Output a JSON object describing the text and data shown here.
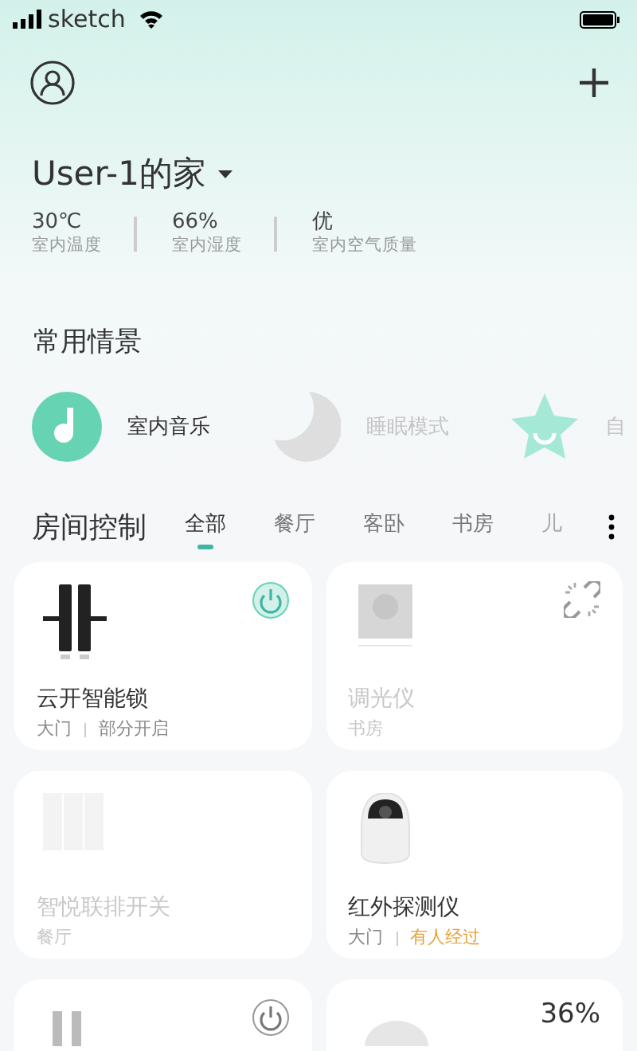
{
  "status_bar": {
    "carrier": "sketch"
  },
  "home": {
    "title": "User-1的家"
  },
  "stats": [
    {
      "value": "30℃",
      "label": "室内温度"
    },
    {
      "value": "66%",
      "label": "室内湿度"
    },
    {
      "value": "优",
      "label": "室内空气质量"
    }
  ],
  "scenes_title": "常用情景",
  "scenes": [
    {
      "kind": "music",
      "label": "室内音乐",
      "active": true
    },
    {
      "kind": "moon",
      "label": "睡眠模式",
      "active": false
    },
    {
      "kind": "star",
      "label": "自",
      "active": false
    }
  ],
  "rooms": {
    "title": "房间控制",
    "tabs": [
      {
        "label": "全部",
        "selected": true
      },
      {
        "label": "餐厅",
        "selected": false
      },
      {
        "label": "客卧",
        "selected": false
      },
      {
        "label": "书房",
        "selected": false
      },
      {
        "label": "儿",
        "selected": false
      }
    ]
  },
  "devices": [
    {
      "kind": "lock",
      "name": "云开智能锁",
      "room": "大门",
      "status": "部分开启",
      "status_alert": false,
      "online": true,
      "unlinked": false,
      "power_on": true
    },
    {
      "kind": "dimmer",
      "name": "调光仪",
      "room": "书房",
      "online": false,
      "unlinked": true
    },
    {
      "kind": "switch",
      "name": "智悦联排开关",
      "room": "餐厅",
      "online": false,
      "unlinked": false
    },
    {
      "kind": "camera",
      "name": "红外探测仪",
      "room": "大门",
      "status": "有人经过",
      "status_alert": true,
      "online": true,
      "unlinked": false
    },
    {
      "kind": "curtain",
      "power_on": false
    },
    {
      "kind": "lamp",
      "reading": "36%"
    }
  ]
}
